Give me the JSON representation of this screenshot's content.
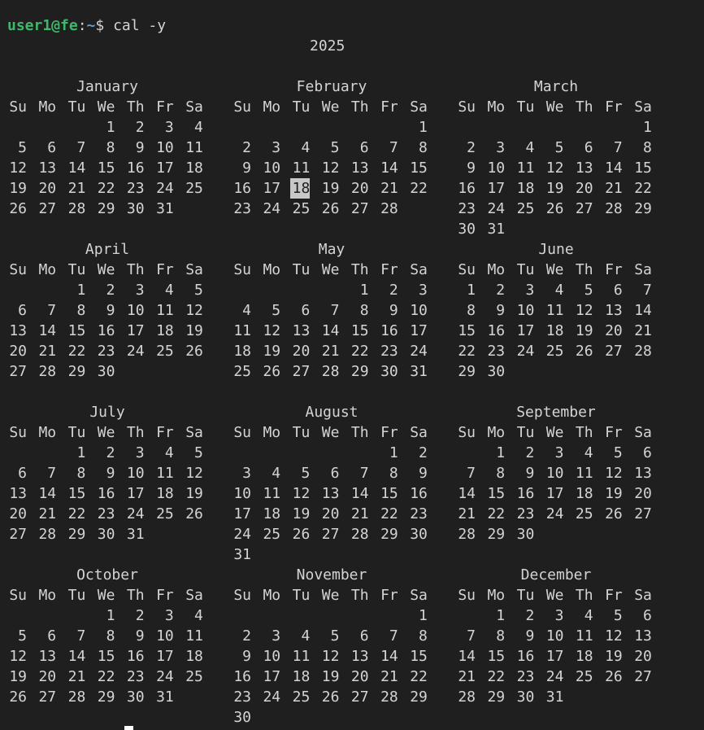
{
  "prompt": {
    "user_host": "user1@fe",
    "separator": ":",
    "path": "~",
    "symbol": "$",
    "command": "cal -y"
  },
  "year": "2025",
  "weekday_labels": [
    "Su",
    "Mo",
    "Tu",
    "We",
    "Th",
    "Fr",
    "Sa"
  ],
  "today": {
    "month": 1,
    "day": 18
  },
  "colors": {
    "background": "#1f1f1f",
    "text": "#d4d4d4",
    "user_host": "#3fb86b",
    "path": "#5aa0d8",
    "today_highlight": "#c8c8c8"
  },
  "months": [
    {
      "name": "January",
      "first_weekday": 3,
      "days": 31
    },
    {
      "name": "February",
      "first_weekday": 6,
      "days": 28
    },
    {
      "name": "March",
      "first_weekday": 6,
      "days": 31
    },
    {
      "name": "April",
      "first_weekday": 2,
      "days": 30
    },
    {
      "name": "May",
      "first_weekday": 4,
      "days": 31
    },
    {
      "name": "June",
      "first_weekday": 0,
      "days": 30
    },
    {
      "name": "July",
      "first_weekday": 2,
      "days": 31
    },
    {
      "name": "August",
      "first_weekday": 5,
      "days": 31
    },
    {
      "name": "September",
      "first_weekday": 1,
      "days": 30
    },
    {
      "name": "October",
      "first_weekday": 3,
      "days": 31
    },
    {
      "name": "November",
      "first_weekday": 6,
      "days": 30
    },
    {
      "name": "December",
      "first_weekday": 1,
      "days": 31
    }
  ]
}
